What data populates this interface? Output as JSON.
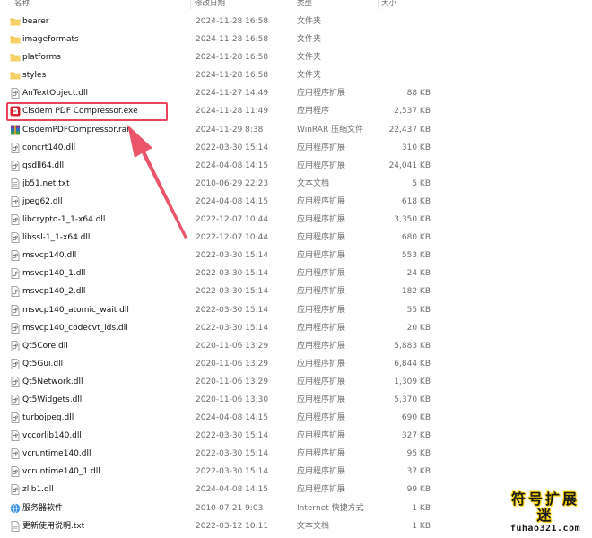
{
  "columns": {
    "name": "名称",
    "date": "修改日期",
    "type": "类型",
    "size": "大小"
  },
  "files": [
    {
      "name": "bearer",
      "date": "2024-11-28 16:58",
      "type": "文件夹",
      "size": "",
      "icon": "folder-icon"
    },
    {
      "name": "imageformats",
      "date": "2024-11-28 16:58",
      "type": "文件夹",
      "size": "",
      "icon": "folder-icon"
    },
    {
      "name": "platforms",
      "date": "2024-11-28 16:58",
      "type": "文件夹",
      "size": "",
      "icon": "folder-icon"
    },
    {
      "name": "styles",
      "date": "2024-11-28 16:58",
      "type": "文件夹",
      "size": "",
      "icon": "folder-icon"
    },
    {
      "name": "AnTextObject.dll",
      "date": "2024-11-27 14:49",
      "type": "应用程序扩展",
      "size": "88 KB",
      "icon": "dll-file-icon"
    },
    {
      "name": "Cisdem PDF Compressor.exe",
      "date": "2024-11-28 11:49",
      "type": "应用程序",
      "size": "2,537 KB",
      "icon": "app-exe-icon"
    },
    {
      "name": "CisdemPDFCompressor.rar",
      "date": "2024-11-29 8:38",
      "type": "WinRAR 压缩文件",
      "size": "22,437 KB",
      "icon": "rar-archive-icon"
    },
    {
      "name": "concrt140.dll",
      "date": "2022-03-30 15:14",
      "type": "应用程序扩展",
      "size": "310 KB",
      "icon": "dll-file-icon"
    },
    {
      "name": "gsdll64.dll",
      "date": "2024-04-08 14:15",
      "type": "应用程序扩展",
      "size": "24,041 KB",
      "icon": "dll-file-icon"
    },
    {
      "name": "jb51.net.txt",
      "date": "2010-06-29 22:23",
      "type": "文本文档",
      "size": "5 KB",
      "icon": "text-file-icon"
    },
    {
      "name": "jpeg62.dll",
      "date": "2024-04-08 14:15",
      "type": "应用程序扩展",
      "size": "618 KB",
      "icon": "dll-file-icon"
    },
    {
      "name": "libcrypto-1_1-x64.dll",
      "date": "2022-12-07 10:44",
      "type": "应用程序扩展",
      "size": "3,350 KB",
      "icon": "dll-file-icon"
    },
    {
      "name": "libssl-1_1-x64.dll",
      "date": "2022-12-07 10:44",
      "type": "应用程序扩展",
      "size": "680 KB",
      "icon": "dll-file-icon"
    },
    {
      "name": "msvcp140.dll",
      "date": "2022-03-30 15:14",
      "type": "应用程序扩展",
      "size": "553 KB",
      "icon": "dll-file-icon"
    },
    {
      "name": "msvcp140_1.dll",
      "date": "2022-03-30 15:14",
      "type": "应用程序扩展",
      "size": "24 KB",
      "icon": "dll-file-icon"
    },
    {
      "name": "msvcp140_2.dll",
      "date": "2022-03-30 15:14",
      "type": "应用程序扩展",
      "size": "182 KB",
      "icon": "dll-file-icon"
    },
    {
      "name": "msvcp140_atomic_wait.dll",
      "date": "2022-03-30 15:14",
      "type": "应用程序扩展",
      "size": "55 KB",
      "icon": "dll-file-icon"
    },
    {
      "name": "msvcp140_codecvt_ids.dll",
      "date": "2022-03-30 15:14",
      "type": "应用程序扩展",
      "size": "20 KB",
      "icon": "dll-file-icon"
    },
    {
      "name": "Qt5Core.dll",
      "date": "2020-11-06 13:29",
      "type": "应用程序扩展",
      "size": "5,883 KB",
      "icon": "dll-file-icon"
    },
    {
      "name": "Qt5Gui.dll",
      "date": "2020-11-06 13:29",
      "type": "应用程序扩展",
      "size": "6,844 KB",
      "icon": "dll-file-icon"
    },
    {
      "name": "Qt5Network.dll",
      "date": "2020-11-06 13:29",
      "type": "应用程序扩展",
      "size": "1,309 KB",
      "icon": "dll-file-icon"
    },
    {
      "name": "Qt5Widgets.dll",
      "date": "2020-11-06 13:30",
      "type": "应用程序扩展",
      "size": "5,370 KB",
      "icon": "dll-file-icon"
    },
    {
      "name": "turbojpeg.dll",
      "date": "2024-04-08 14:15",
      "type": "应用程序扩展",
      "size": "690 KB",
      "icon": "dll-file-icon"
    },
    {
      "name": "vccorlib140.dll",
      "date": "2022-03-30 15:14",
      "type": "应用程序扩展",
      "size": "327 KB",
      "icon": "dll-file-icon"
    },
    {
      "name": "vcruntime140.dll",
      "date": "2022-03-30 15:14",
      "type": "应用程序扩展",
      "size": "95 KB",
      "icon": "dll-file-icon"
    },
    {
      "name": "vcruntime140_1.dll",
      "date": "2022-03-30 15:14",
      "type": "应用程序扩展",
      "size": "37 KB",
      "icon": "dll-file-icon"
    },
    {
      "name": "zlib1.dll",
      "date": "2024-04-08 14:15",
      "type": "应用程序扩展",
      "size": "99 KB",
      "icon": "dll-file-icon"
    },
    {
      "name": "服务器软件",
      "date": "2010-07-21 9:03",
      "type": "Internet 快捷方式",
      "size": "1 KB",
      "icon": "internet-shortcut-icon"
    },
    {
      "name": "更新使用说明.txt",
      "date": "2022-03-12 10:11",
      "type": "文本文档",
      "size": "1 KB",
      "icon": "text-file-icon"
    }
  ],
  "watermark": {
    "title": "符号扩展迷",
    "url": "fuhao321.com"
  },
  "colors": {
    "highlight": "#e8465c",
    "folder": "#f0c14b",
    "arrow": "#e8465c"
  }
}
